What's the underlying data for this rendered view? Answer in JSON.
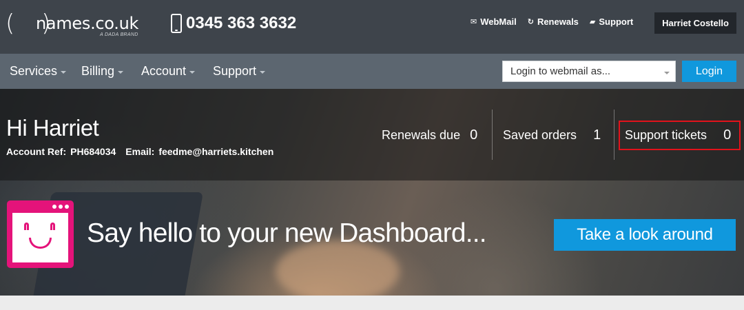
{
  "header": {
    "logo_text": "names.co.uk",
    "logo_subtitle": "A DADA BRAND",
    "phone": "0345 363 3632",
    "links": [
      {
        "label": "WebMail",
        "icon": "envelope-icon"
      },
      {
        "label": "Renewals",
        "icon": "refresh-icon"
      },
      {
        "label": "Support",
        "icon": "chat-icon"
      }
    ],
    "user_name": "Harriet Costello"
  },
  "nav": {
    "items": [
      "Services",
      "Billing",
      "Account",
      "Support"
    ],
    "webmail_placeholder": "Login to webmail as...",
    "login_label": "Login"
  },
  "dashboard": {
    "greeting": "Hi Harriet",
    "account_ref_label": "Account Ref:",
    "account_ref": "PH684034",
    "email_label": "Email:",
    "email": "feedme@harriets.kitchen",
    "stats": [
      {
        "label": "Renewals due",
        "value": "0"
      },
      {
        "label": "Saved orders",
        "value": "1"
      },
      {
        "label": "Support tickets",
        "value": "0"
      }
    ]
  },
  "banner": {
    "text": "Say hello to your new Dashboard...",
    "cta": "Take a look around"
  },
  "colors": {
    "topbar": "#3e444b",
    "navbar": "#5c6670",
    "accent_blue": "#1098dd",
    "brand_pink": "#e4137a",
    "highlight_red": "#e3121b"
  }
}
